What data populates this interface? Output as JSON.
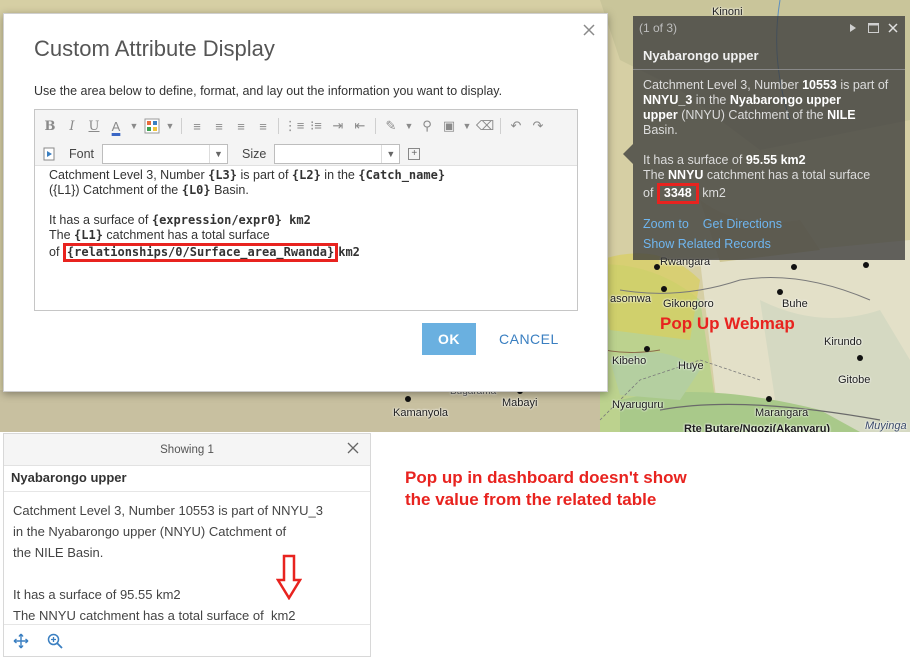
{
  "colors": {
    "annotation_red": "#e8231f",
    "ok_button": "#6ab0e0",
    "link_blue": "#6fb6f0",
    "popup_bg": "#3c3c3c"
  },
  "map": {
    "places": {
      "kinoni": "Kinoni",
      "rwangara": "Rwangara",
      "masomwa": "asomwa",
      "gikongoro": "Gikongoro",
      "buhe": "Buhe",
      "kibeho": "Kibeho",
      "huye": "Huye",
      "kirundo": "Kirundo",
      "gitobe": "Gitobe",
      "kamanyola": "Kamanyola",
      "mabayi": "Mabayi",
      "nyaruguru": "Nyaruguru",
      "marangara": "Marangara",
      "muyinga": "Muyinga",
      "road": "Rte Butare/Ngozi(Akanyaru)",
      "bugarama": "Bugarama"
    },
    "annotation": "Pop Up Webmap"
  },
  "map_popup": {
    "counter": "(1 of 3)",
    "title": "Nyabarongo upper",
    "body": {
      "p1_a": "Catchment Level 3, Number ",
      "p1_num": "10553",
      "p1_b": " is part of ",
      "p1_code": "NNYU_3",
      "p1_c": " in the ",
      "p1_name": "Nyabarongo upper",
      "p1_d": " (NNYU) Catchment of the ",
      "p1_basin": "NILE",
      "p1_e": " Basin.",
      "p2_a": "It has a surface of ",
      "p2_surface": "95.55 km2",
      "p3_a": "The ",
      "p3_code": "NNYU",
      "p3_b": " catchment has a total surface",
      "p3_c": "of ",
      "p3_value": "3348",
      "p3_unit": " km2"
    },
    "links": {
      "zoom": "Zoom to",
      "directions": "Get Directions",
      "related": "Show Related Records"
    },
    "icons": [
      "play-icon",
      "maximize-icon",
      "close-icon"
    ]
  },
  "dialog": {
    "title": "Custom Attribute Display",
    "description": "Use the area below to define, format, and lay out the information you want to display.",
    "toolbar": {
      "bold": "B",
      "italic": "I",
      "underline": "U",
      "font_color": "A",
      "font_label": "Font",
      "size_label": "Size"
    },
    "content": {
      "l1_a": "Catchment Level 3, Number ",
      "l1_f1": "{L3}",
      "l1_b": " is part of ",
      "l1_f2": "{L2}",
      "l1_c": " in the ",
      "l1_f3": "{Catch_name}",
      "l2_a": "({L1}) Catchment of the ",
      "l2_f1": "{L0}",
      "l2_b": " Basin.",
      "l3_a": "It has a surface of ",
      "l3_f1": "{expression/expr0}",
      "l3_b": " km2",
      "l4_a": "The ",
      "l4_f1": "{L1}",
      "l4_b": " catchment has a total surface",
      "l5_a": "of ",
      "l5_f1": "{relationships/0/Surface_area_Rwanda}",
      "l5_b": "km2"
    },
    "ok_label": "OK",
    "cancel_label": "CANCEL"
  },
  "dashboard_popup": {
    "header": "Showing 1",
    "title": "Nyabarongo upper",
    "body": {
      "p1_a": "Catchment Level 3, Number ",
      "p1_num": "10553",
      "p1_b": " is part of ",
      "p1_code": "NNYU_3",
      "p1_c": "in the ",
      "p1_name": "Nyabarongo upper",
      "p1_d": " (NNYU) Catchment of",
      "p1_e": "the ",
      "p1_basin": "NILE",
      "p1_f": " Basin.",
      "p2_a": "It has a surface of ",
      "p2_surface": "95.55 km2",
      "p3_a": "The ",
      "p3_code": "NNYU",
      "p3_b": " catchment has a total surface of  ",
      "p3_unit": "km2"
    }
  },
  "annotation_dashboard": {
    "line1": "Pop up in dashboard doesn't show",
    "line2": "the value from the related table"
  }
}
